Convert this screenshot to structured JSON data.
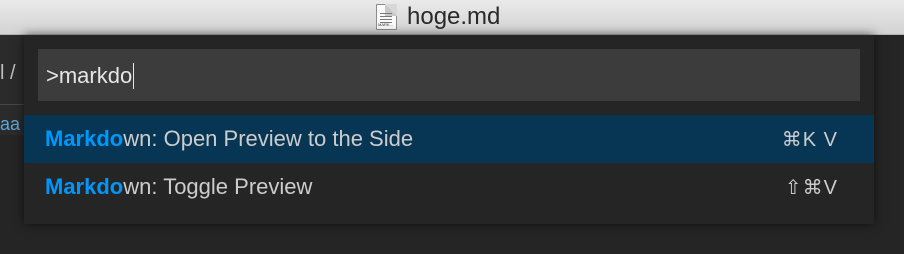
{
  "window": {
    "title": "hoge.md",
    "file_icon_tag": "MARK..."
  },
  "editor": {
    "fragment_top": "l /",
    "fragment_mid": "aa"
  },
  "palette": {
    "input_value": ">markdo",
    "items": [
      {
        "highlight": "Markdo",
        "rest": "wn: Open Preview to the Side",
        "keybinding": "⌘K V",
        "selected": true
      },
      {
        "highlight": "Markdo",
        "rest": "wn: Toggle Preview",
        "keybinding": "⇧⌘V",
        "selected": false
      }
    ]
  },
  "colors": {
    "highlight": "#0097fb",
    "selected_row": "#073655",
    "input_bg": "#3c3c3c"
  }
}
